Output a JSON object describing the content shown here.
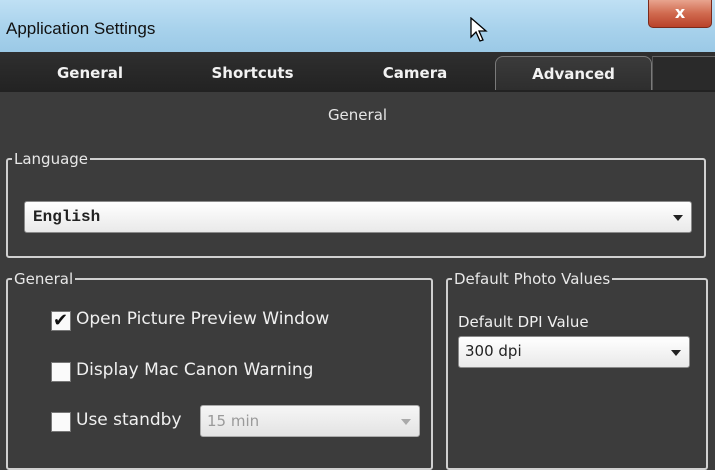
{
  "window": {
    "title": "Application Settings",
    "close_label": "x"
  },
  "tabs": [
    {
      "label": "General",
      "active": false
    },
    {
      "label": "Shortcuts",
      "active": false
    },
    {
      "label": "Camera",
      "active": false
    },
    {
      "label": "Advanced",
      "active": true
    }
  ],
  "content": {
    "section_title": "General",
    "language": {
      "legend": "Language",
      "selected": "English"
    },
    "general": {
      "legend": "General",
      "open_preview": {
        "label": "Open Picture Preview Window",
        "checked": true
      },
      "mac_warning": {
        "label": "Display Mac Canon Warning",
        "checked": false
      },
      "standby": {
        "label": "Use standby",
        "checked": false,
        "value": "15 min"
      }
    },
    "photo": {
      "legend": "Default Photo Values",
      "dpi_label": "Default DPI Value",
      "dpi_value": "300 dpi"
    }
  },
  "icons": {
    "checkmark": "✔",
    "cursor": "arrow-cursor-icon"
  }
}
